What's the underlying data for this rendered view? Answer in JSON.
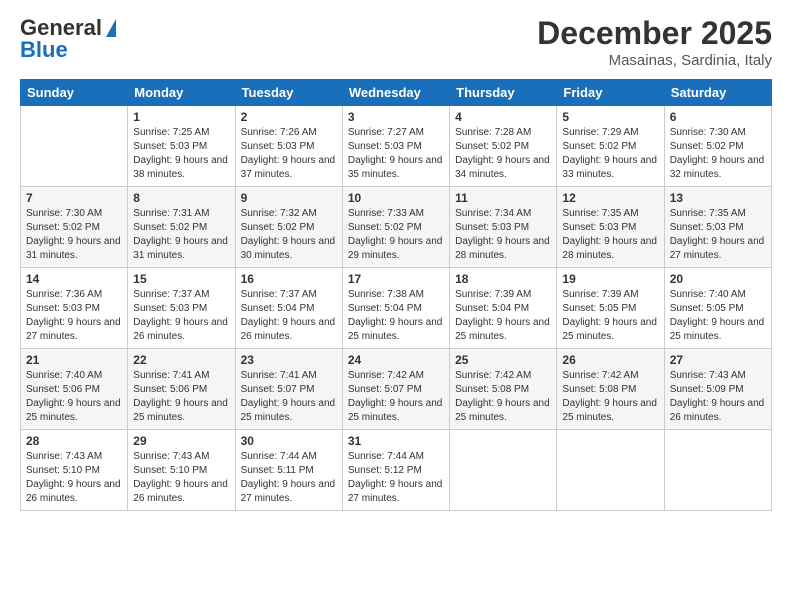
{
  "header": {
    "logo_general": "General",
    "logo_blue": "Blue",
    "month": "December 2025",
    "location": "Masainas, Sardinia, Italy"
  },
  "weekdays": [
    "Sunday",
    "Monday",
    "Tuesday",
    "Wednesday",
    "Thursday",
    "Friday",
    "Saturday"
  ],
  "weeks": [
    [
      {
        "day": "",
        "sunrise": "",
        "sunset": "",
        "daylight": ""
      },
      {
        "day": "1",
        "sunrise": "Sunrise: 7:25 AM",
        "sunset": "Sunset: 5:03 PM",
        "daylight": "Daylight: 9 hours and 38 minutes."
      },
      {
        "day": "2",
        "sunrise": "Sunrise: 7:26 AM",
        "sunset": "Sunset: 5:03 PM",
        "daylight": "Daylight: 9 hours and 37 minutes."
      },
      {
        "day": "3",
        "sunrise": "Sunrise: 7:27 AM",
        "sunset": "Sunset: 5:03 PM",
        "daylight": "Daylight: 9 hours and 35 minutes."
      },
      {
        "day": "4",
        "sunrise": "Sunrise: 7:28 AM",
        "sunset": "Sunset: 5:02 PM",
        "daylight": "Daylight: 9 hours and 34 minutes."
      },
      {
        "day": "5",
        "sunrise": "Sunrise: 7:29 AM",
        "sunset": "Sunset: 5:02 PM",
        "daylight": "Daylight: 9 hours and 33 minutes."
      },
      {
        "day": "6",
        "sunrise": "Sunrise: 7:30 AM",
        "sunset": "Sunset: 5:02 PM",
        "daylight": "Daylight: 9 hours and 32 minutes."
      }
    ],
    [
      {
        "day": "7",
        "sunrise": "Sunrise: 7:30 AM",
        "sunset": "Sunset: 5:02 PM",
        "daylight": "Daylight: 9 hours and 31 minutes."
      },
      {
        "day": "8",
        "sunrise": "Sunrise: 7:31 AM",
        "sunset": "Sunset: 5:02 PM",
        "daylight": "Daylight: 9 hours and 31 minutes."
      },
      {
        "day": "9",
        "sunrise": "Sunrise: 7:32 AM",
        "sunset": "Sunset: 5:02 PM",
        "daylight": "Daylight: 9 hours and 30 minutes."
      },
      {
        "day": "10",
        "sunrise": "Sunrise: 7:33 AM",
        "sunset": "Sunset: 5:02 PM",
        "daylight": "Daylight: 9 hours and 29 minutes."
      },
      {
        "day": "11",
        "sunrise": "Sunrise: 7:34 AM",
        "sunset": "Sunset: 5:03 PM",
        "daylight": "Daylight: 9 hours and 28 minutes."
      },
      {
        "day": "12",
        "sunrise": "Sunrise: 7:35 AM",
        "sunset": "Sunset: 5:03 PM",
        "daylight": "Daylight: 9 hours and 28 minutes."
      },
      {
        "day": "13",
        "sunrise": "Sunrise: 7:35 AM",
        "sunset": "Sunset: 5:03 PM",
        "daylight": "Daylight: 9 hours and 27 minutes."
      }
    ],
    [
      {
        "day": "14",
        "sunrise": "Sunrise: 7:36 AM",
        "sunset": "Sunset: 5:03 PM",
        "daylight": "Daylight: 9 hours and 27 minutes."
      },
      {
        "day": "15",
        "sunrise": "Sunrise: 7:37 AM",
        "sunset": "Sunset: 5:03 PM",
        "daylight": "Daylight: 9 hours and 26 minutes."
      },
      {
        "day": "16",
        "sunrise": "Sunrise: 7:37 AM",
        "sunset": "Sunset: 5:04 PM",
        "daylight": "Daylight: 9 hours and 26 minutes."
      },
      {
        "day": "17",
        "sunrise": "Sunrise: 7:38 AM",
        "sunset": "Sunset: 5:04 PM",
        "daylight": "Daylight: 9 hours and 25 minutes."
      },
      {
        "day": "18",
        "sunrise": "Sunrise: 7:39 AM",
        "sunset": "Sunset: 5:04 PM",
        "daylight": "Daylight: 9 hours and 25 minutes."
      },
      {
        "day": "19",
        "sunrise": "Sunrise: 7:39 AM",
        "sunset": "Sunset: 5:05 PM",
        "daylight": "Daylight: 9 hours and 25 minutes."
      },
      {
        "day": "20",
        "sunrise": "Sunrise: 7:40 AM",
        "sunset": "Sunset: 5:05 PM",
        "daylight": "Daylight: 9 hours and 25 minutes."
      }
    ],
    [
      {
        "day": "21",
        "sunrise": "Sunrise: 7:40 AM",
        "sunset": "Sunset: 5:06 PM",
        "daylight": "Daylight: 9 hours and 25 minutes."
      },
      {
        "day": "22",
        "sunrise": "Sunrise: 7:41 AM",
        "sunset": "Sunset: 5:06 PM",
        "daylight": "Daylight: 9 hours and 25 minutes."
      },
      {
        "day": "23",
        "sunrise": "Sunrise: 7:41 AM",
        "sunset": "Sunset: 5:07 PM",
        "daylight": "Daylight: 9 hours and 25 minutes."
      },
      {
        "day": "24",
        "sunrise": "Sunrise: 7:42 AM",
        "sunset": "Sunset: 5:07 PM",
        "daylight": "Daylight: 9 hours and 25 minutes."
      },
      {
        "day": "25",
        "sunrise": "Sunrise: 7:42 AM",
        "sunset": "Sunset: 5:08 PM",
        "daylight": "Daylight: 9 hours and 25 minutes."
      },
      {
        "day": "26",
        "sunrise": "Sunrise: 7:42 AM",
        "sunset": "Sunset: 5:08 PM",
        "daylight": "Daylight: 9 hours and 25 minutes."
      },
      {
        "day": "27",
        "sunrise": "Sunrise: 7:43 AM",
        "sunset": "Sunset: 5:09 PM",
        "daylight": "Daylight: 9 hours and 26 minutes."
      }
    ],
    [
      {
        "day": "28",
        "sunrise": "Sunrise: 7:43 AM",
        "sunset": "Sunset: 5:10 PM",
        "daylight": "Daylight: 9 hours and 26 minutes."
      },
      {
        "day": "29",
        "sunrise": "Sunrise: 7:43 AM",
        "sunset": "Sunset: 5:10 PM",
        "daylight": "Daylight: 9 hours and 26 minutes."
      },
      {
        "day": "30",
        "sunrise": "Sunrise: 7:44 AM",
        "sunset": "Sunset: 5:11 PM",
        "daylight": "Daylight: 9 hours and 27 minutes."
      },
      {
        "day": "31",
        "sunrise": "Sunrise: 7:44 AM",
        "sunset": "Sunset: 5:12 PM",
        "daylight": "Daylight: 9 hours and 27 minutes."
      },
      {
        "day": "",
        "sunrise": "",
        "sunset": "",
        "daylight": ""
      },
      {
        "day": "",
        "sunrise": "",
        "sunset": "",
        "daylight": ""
      },
      {
        "day": "",
        "sunrise": "",
        "sunset": "",
        "daylight": ""
      }
    ]
  ]
}
